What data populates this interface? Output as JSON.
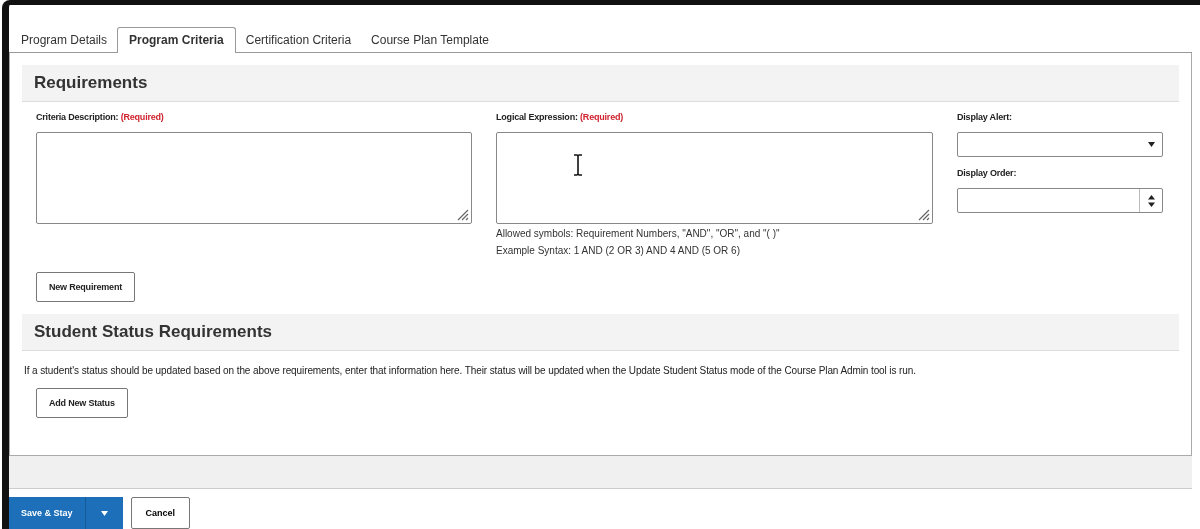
{
  "tabs": [
    {
      "label": "Program Details",
      "selected": false
    },
    {
      "label": "Program Criteria",
      "selected": true
    },
    {
      "label": "Certification Criteria",
      "selected": false
    },
    {
      "label": "Course Plan Template",
      "selected": false
    }
  ],
  "requirements": {
    "title": "Requirements",
    "criteria_description": {
      "label": "Criteria Description:",
      "required": "(Required)"
    },
    "logical_expression": {
      "label": "Logical Expression:",
      "required": "(Required)",
      "help": [
        "Allowed symbols: Requirement Numbers, \"AND\", \"OR\", and \"( )\"",
        "Example Syntax: 1 AND (2 OR 3) AND 4 AND (5 OR 6)"
      ]
    },
    "display_alert": {
      "label": "Display Alert:"
    },
    "display_order": {
      "label": "Display Order:"
    },
    "button": "New Requirement"
  },
  "student_status": {
    "title": "Student Status Requirements",
    "description": "If a student's status should be updated based on the above requirements, enter that information here. Their status will be updated when the Update Student Status mode of the Course Plan Admin tool is run.",
    "button": "Add New Status"
  },
  "footer": {
    "save": "Save & Stay",
    "cancel": "Cancel"
  }
}
